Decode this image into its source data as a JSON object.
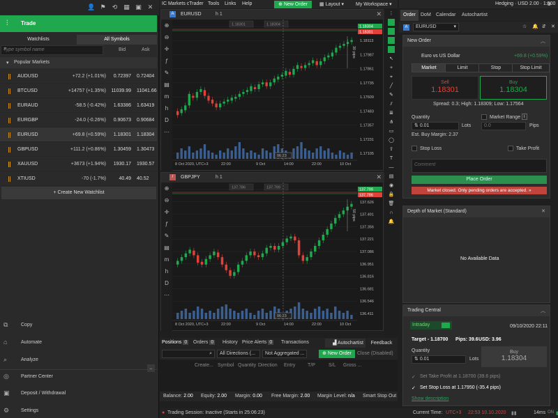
{
  "app": {
    "title": "IC Markets cTrader",
    "menus": [
      "Tools",
      "Links",
      "Help"
    ],
    "new_order": "New Order",
    "layout": "Layout",
    "workspace": "My Workspace",
    "account": "Hedging · USD 2.00 · 1:500"
  },
  "left": {
    "trade_label": "Trade",
    "tabs": [
      "Watchlists",
      "All Symbols"
    ],
    "search_placeholder": "Type symbol name",
    "col_bid": "Bid",
    "col_ask": "Ask",
    "popular": "Popular Markets",
    "markets": [
      {
        "symbol": "AUDUSD",
        "change": "+72.2 (+1.01%)",
        "bid": "0.72397",
        "ask": "0.72404"
      },
      {
        "symbol": "BTCUSD",
        "change": "+14757 (+1.35%)",
        "bid": "11039.99",
        "ask": "11041.66"
      },
      {
        "symbol": "EURAUD",
        "change": "-58.5 (-0.42%)",
        "bid": "1.63386",
        "ask": "1.63419"
      },
      {
        "symbol": "EURGBP",
        "change": "-24.0 (-0.26%)",
        "bid": "0.90673",
        "ask": "0.90684"
      },
      {
        "symbol": "EURUSD",
        "change": "+69.8 (+0.59%)",
        "bid": "1.18301",
        "ask": "1.18304"
      },
      {
        "symbol": "GBPUSD",
        "change": "+111.2 (+0.86%)",
        "bid": "1.30459",
        "ask": "1.30473"
      },
      {
        "symbol": "XAUUSD",
        "change": "+3673 (+1.94%)",
        "bid": "1930.17",
        "ask": "1930.57"
      },
      {
        "symbol": "XTIUSD",
        "change": "-70 (-1.7%)",
        "bid": "40.49",
        "ask": "40.52"
      }
    ],
    "create_watchlist": "+ Create New Watchlist",
    "nav": [
      {
        "icon": "copy-icon",
        "label": "Copy"
      },
      {
        "icon": "automate-icon",
        "label": "Automate"
      },
      {
        "icon": "analyze-icon",
        "label": "Analyze"
      },
      {
        "icon": "partner-icon",
        "label": "Partner Center"
      },
      {
        "icon": "deposit-icon",
        "label": "Deposit / Withdrawal"
      },
      {
        "icon": "settings-icon",
        "label": "Settings"
      }
    ]
  },
  "charts": [
    {
      "symbol": "EURUSD",
      "timeframe": "h 1",
      "tag_sell": "1.18301",
      "tag_buy": "1.18304",
      "period_label": "30 pips",
      "bar_countdown": "06:23",
      "sell_label": "Sell",
      "buy_label": "Buy",
      "y_ticks": [
        "1.18239",
        "1.18113",
        "1.17987",
        "1.17861",
        "1.17735",
        "1.17609",
        "1.17483",
        "1.17357",
        "1.17231",
        "1.17105"
      ],
      "x_ticks": [
        "8 Oct 2020, UTC+3",
        "22:00",
        "9 Oct",
        "14:00",
        "22:00",
        "10 Oct"
      ],
      "candles": [
        [
          0.78,
          0.82
        ],
        [
          0.8,
          0.76
        ],
        [
          0.77,
          0.72
        ],
        [
          0.72,
          0.6
        ],
        [
          0.62,
          0.64
        ],
        [
          0.64,
          0.58
        ],
        [
          0.58,
          0.55
        ],
        [
          0.56,
          0.62
        ],
        [
          0.62,
          0.67
        ],
        [
          0.66,
          0.7
        ],
        [
          0.7,
          0.74
        ],
        [
          0.74,
          0.7
        ],
        [
          0.7,
          0.68
        ],
        [
          0.68,
          0.66
        ],
        [
          0.67,
          0.64
        ],
        [
          0.65,
          0.63
        ],
        [
          0.63,
          0.6
        ],
        [
          0.6,
          0.58
        ],
        [
          0.58,
          0.56
        ],
        [
          0.57,
          0.52
        ],
        [
          0.53,
          0.55
        ],
        [
          0.55,
          0.5
        ],
        [
          0.5,
          0.48
        ],
        [
          0.48,
          0.52
        ],
        [
          0.52,
          0.48
        ],
        [
          0.48,
          0.44
        ],
        [
          0.45,
          0.42
        ],
        [
          0.42,
          0.4
        ],
        [
          0.41,
          0.36
        ],
        [
          0.37,
          0.4
        ],
        [
          0.4,
          0.34
        ],
        [
          0.34,
          0.3
        ],
        [
          0.31,
          0.33
        ],
        [
          0.33,
          0.3
        ],
        [
          0.3,
          0.28
        ],
        [
          0.28,
          0.25
        ],
        [
          0.26,
          0.3
        ],
        [
          0.3,
          0.26
        ],
        [
          0.26,
          0.22
        ],
        [
          0.22,
          0.2
        ],
        [
          0.21,
          0.17
        ],
        [
          0.17,
          0.12
        ],
        [
          0.12,
          0.1
        ],
        [
          0.1,
          0.08
        ],
        [
          0.08,
          0.06
        ],
        [
          0.06,
          0.04
        ]
      ],
      "volumes": [
        0.3,
        0.5,
        0.4,
        0.6,
        0.3,
        0.4,
        0.5,
        0.7,
        0.4,
        0.3,
        0.2,
        0.4,
        0.3,
        0.5,
        0.4,
        0.6,
        0.8,
        0.5,
        0.3,
        0.4,
        0.3,
        0.2,
        0.5,
        0.4,
        0.3,
        0.6,
        0.7,
        0.5,
        0.4,
        0.3,
        0.5,
        0.6,
        0.8,
        0.5,
        0.4,
        0.3,
        0.5,
        0.6,
        0.4,
        0.5,
        0.3,
        0.2,
        0.4,
        0.3,
        0.2,
        0.3
      ]
    },
    {
      "symbol": "GBPJPY",
      "timeframe": "h 1",
      "tag_sell": "137.786",
      "tag_buy": "137.799",
      "period_label": "50 pips",
      "bar_countdown": "06:23",
      "sell_label": "137.786",
      "buy_label": "137.799",
      "y_ticks": [
        "137.761",
        "137.626",
        "137.491",
        "137.356",
        "137.221",
        "137.086",
        "136.951",
        "136.816",
        "136.681",
        "136.546",
        "136.411"
      ],
      "x_ticks": [
        "8 Oct 2020, UTC+3",
        "22:00",
        "9 Oct",
        "14:00",
        "22:00",
        "10 Oct"
      ],
      "candles": [
        [
          0.7,
          0.66
        ],
        [
          0.66,
          0.62
        ],
        [
          0.62,
          0.58
        ],
        [
          0.58,
          0.54
        ],
        [
          0.55,
          0.6
        ],
        [
          0.6,
          0.68
        ],
        [
          0.67,
          0.7
        ],
        [
          0.7,
          0.64
        ],
        [
          0.64,
          0.6
        ],
        [
          0.6,
          0.56
        ],
        [
          0.57,
          0.62
        ],
        [
          0.62,
          0.7
        ],
        [
          0.7,
          0.76
        ],
        [
          0.76,
          0.82
        ],
        [
          0.82,
          0.78
        ],
        [
          0.78,
          0.7
        ],
        [
          0.7,
          0.66
        ],
        [
          0.66,
          0.6
        ],
        [
          0.6,
          0.56
        ],
        [
          0.56,
          0.6
        ],
        [
          0.6,
          0.62
        ],
        [
          0.62,
          0.58
        ],
        [
          0.58,
          0.52
        ],
        [
          0.52,
          0.5
        ],
        [
          0.5,
          0.54
        ],
        [
          0.54,
          0.5
        ],
        [
          0.5,
          0.46
        ],
        [
          0.46,
          0.42
        ],
        [
          0.42,
          0.4
        ],
        [
          0.4,
          0.44
        ],
        [
          0.44,
          0.6
        ],
        [
          0.6,
          0.66
        ],
        [
          0.66,
          0.62
        ],
        [
          0.62,
          0.56
        ],
        [
          0.56,
          0.5
        ],
        [
          0.5,
          0.44
        ],
        [
          0.44,
          0.38
        ],
        [
          0.38,
          0.32
        ],
        [
          0.32,
          0.26
        ],
        [
          0.26,
          0.2
        ],
        [
          0.2,
          0.16
        ],
        [
          0.16,
          0.12
        ],
        [
          0.12,
          0.08
        ],
        [
          0.08,
          0.05
        ]
      ],
      "volumes": [
        0.3,
        0.4,
        0.5,
        0.3,
        0.4,
        0.6,
        0.5,
        0.3,
        0.4,
        0.3,
        0.5,
        0.6,
        0.7,
        0.5,
        0.4,
        0.3,
        0.4,
        0.5,
        0.3,
        0.2,
        0.4,
        0.5,
        0.3,
        0.4,
        0.6,
        0.5,
        0.3,
        0.4,
        0.5,
        0.6,
        0.8,
        0.5,
        0.4,
        0.3,
        0.5,
        0.6,
        0.4,
        0.5,
        0.3,
        0.6,
        0.4,
        0.3,
        0.4,
        0.2
      ]
    }
  ],
  "positions": {
    "tabs": [
      {
        "label": "Positions",
        "count": "0"
      },
      {
        "label": "Orders",
        "count": "0"
      },
      {
        "label": "History",
        "count": ""
      },
      {
        "label": "Price Alerts",
        "count": "0"
      },
      {
        "label": "Transactions",
        "count": ""
      }
    ],
    "autochartist": "Autochartist",
    "feedback": "Feedback",
    "filter_direction": "All Directions (...",
    "filter_aggregated": "Not Aggregated ...",
    "new_order": "New Order",
    "close_disabled": "Close (Disabled)",
    "columns": [
      "Create...",
      "Symbol",
      "Quantity",
      "Direction",
      "Entry",
      "T/P",
      "S/L",
      "Gross ..."
    ],
    "balance": [
      {
        "k": "Balance:",
        "v": "2.00"
      },
      {
        "k": "Equity:",
        "v": "2.00"
      },
      {
        "k": "Margin:",
        "v": "0.00"
      },
      {
        "k": "Free Margin:",
        "v": "2.00"
      },
      {
        "k": "Margin Level:",
        "v": "n/a"
      },
      {
        "k": "Smart Stop Out",
        "v": ""
      }
    ]
  },
  "status": {
    "session": "Trading Session: Inactive (Starts in 25:06:23)",
    "current_time_label": "Current Time:",
    "tz": "UTC+3",
    "time": "22:53 10.10.2020",
    "latency": "14ms",
    "latency2": "44ms"
  },
  "right": {
    "tabs": [
      "Order",
      "DoM",
      "Calendar",
      "Autochartist"
    ],
    "symbol": "EURUSD",
    "new_order_title": "New Order",
    "pair_name": "Euro vs US Dollar",
    "pair_change": "+69.8 (+0.59%)",
    "order_types": [
      "Market",
      "Limit",
      "Stop",
      "Stop Limit"
    ],
    "sell_label": "Sell",
    "sell_price": "1.18301",
    "buy_label": "Buy",
    "buy_price": "1.18304",
    "spread": "Spread: 0.3; High: 1.18309; Low: 1.17564",
    "quantity_label": "Quantity",
    "quantity_value": "0.01",
    "lots": "Lots",
    "market_range": "Market Range",
    "range_value": "0.0",
    "pips": "Pips",
    "est_margin": "Est. Buy Margin: 2.37",
    "stop_loss": "Stop Loss",
    "take_profit": "Take Profit",
    "comment_placeholder": "Comment",
    "place_order": "Place Order",
    "market_closed": "Market closed. Only pending orders are accepted.",
    "dom_title": "Depth of Market (Standard)",
    "dom_empty": "No Available Data",
    "tc_title": "Trading Central",
    "tc_period": "Intraday",
    "tc_date": "09/10/2020 22:11",
    "tc_target": "Target - 1.18700",
    "tc_pips": "Pips: 39.6",
    "tc_usd": "USD: 3.96",
    "tc_qty_label": "Quantity",
    "tc_qty": "0.01",
    "tc_lots": "Lots",
    "tc_buy": "Buy",
    "tc_buy_price": "1.18304",
    "tc_tp": "Set Take Profit at 1.18700 (39.6 pips)",
    "tc_sl": "Set Stop Loss at 1.17950 (-35.4 pips)",
    "tc_desc": "Show description"
  },
  "colors": {
    "green": "#1fa84d",
    "red": "#e0423a",
    "accent": "#2d8f4e"
  }
}
